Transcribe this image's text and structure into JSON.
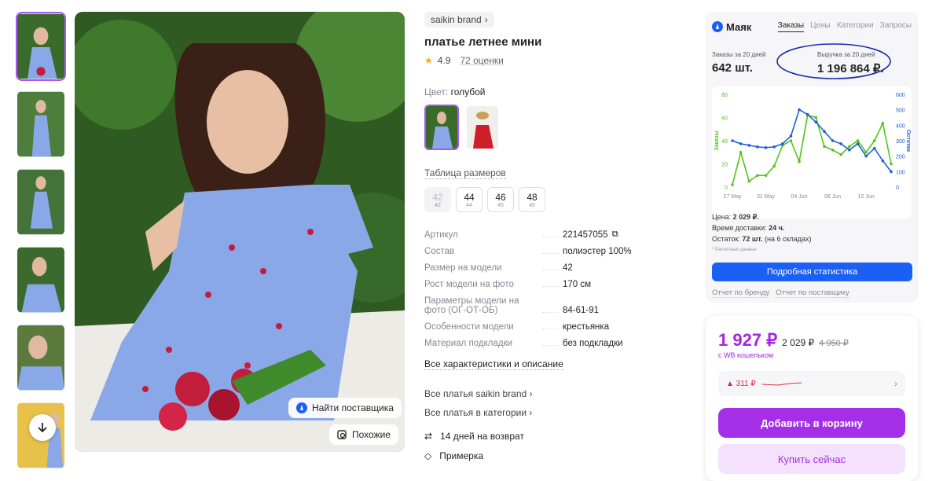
{
  "gallery": {
    "find_supplier": "Найти поставщика",
    "similar": "Похожие"
  },
  "product": {
    "brand": "saikin brand",
    "title": "платье летнее мини",
    "rating": "4.9",
    "reviews": "72 оценки",
    "color_label": "Цвет:",
    "color_value": "голубой",
    "size_table": "Таблица размеров",
    "sizes": [
      {
        "main": "42",
        "sub": "42"
      },
      {
        "main": "44",
        "sub": "44"
      },
      {
        "main": "46",
        "sub": "46"
      },
      {
        "main": "48",
        "sub": "48"
      }
    ],
    "specs": [
      {
        "k": "Артикул",
        "v": "221457055"
      },
      {
        "k": "Состав",
        "v": "полиэстер 100%"
      },
      {
        "k": "Размер на модели",
        "v": "42"
      },
      {
        "k": "Рост модели на фото",
        "v": "170 см"
      },
      {
        "k": "Параметры модели на фото (ОГ-ОТ-ОБ)",
        "v": "84-61-91"
      },
      {
        "k": "Особенности модели",
        "v": "крестьянка"
      },
      {
        "k": "Материал подкладки",
        "v": "без подкладки"
      }
    ],
    "all_specs": "Все характеристики и описание",
    "link_brand": "Все платья saikin brand",
    "link_category": "Все платья в категории",
    "return_text": "14 дней на возврат",
    "fitting_text": "Примерка"
  },
  "mayak": {
    "logo": "Маяк",
    "tabs": [
      "Заказы",
      "Цены",
      "Категории",
      "Запросы"
    ],
    "orders_label": "Заказы за 20 дней",
    "orders_value": "642 шт.",
    "revenue_label": "Выручка за 20 дней",
    "revenue_value": "1 196 864 ₽.",
    "price_label": "Цена:",
    "price_value": "2 029 ₽.",
    "delivery_label": "Время доставки:",
    "delivery_value": "24 ч.",
    "stock_label": "Остаток:",
    "stock_value": "72 шт.",
    "stock_extra": "(на 6 складах)",
    "note": "* Расчетные данные",
    "button": "Подробная статистика",
    "report_brand": "Отчет по бренду",
    "report_supplier": "Отчет по поставщику"
  },
  "chart_data": {
    "type": "line",
    "x_ticks": [
      "27 May",
      "31 May",
      "04 Jun",
      "08 Jun",
      "12 Jun"
    ],
    "left_axis": {
      "label": "Заказы",
      "ticks": [
        0,
        20,
        40,
        60,
        80
      ],
      "ylim": [
        0,
        80
      ]
    },
    "right_axis": {
      "label": "Остатки",
      "ticks": [
        0,
        100,
        200,
        300,
        400,
        500,
        600
      ],
      "ylim": [
        0,
        600
      ]
    },
    "series": [
      {
        "name": "Заказы",
        "axis": "left",
        "color": "#53c41a",
        "values": [
          2,
          30,
          5,
          10,
          10,
          18,
          36,
          40,
          22,
          62,
          60,
          35,
          32,
          28,
          35,
          40,
          30,
          40,
          55,
          20
        ]
      },
      {
        "name": "Остатки",
        "axis": "right",
        "color": "#1f5fd6",
        "values": [
          300,
          280,
          270,
          260,
          255,
          260,
          280,
          330,
          500,
          470,
          420,
          360,
          300,
          280,
          240,
          280,
          200,
          250,
          170,
          100
        ]
      }
    ]
  },
  "buy": {
    "price": "1 927 ₽",
    "price_regular": "2 029 ₽",
    "price_old": "4 950 ₽",
    "wallet": "с WB кошельком",
    "history": "▲ 311 ₽",
    "add_cart": "Добавить в корзину",
    "buy_now": "Купить сейчас",
    "accent": "#a52fe8"
  }
}
